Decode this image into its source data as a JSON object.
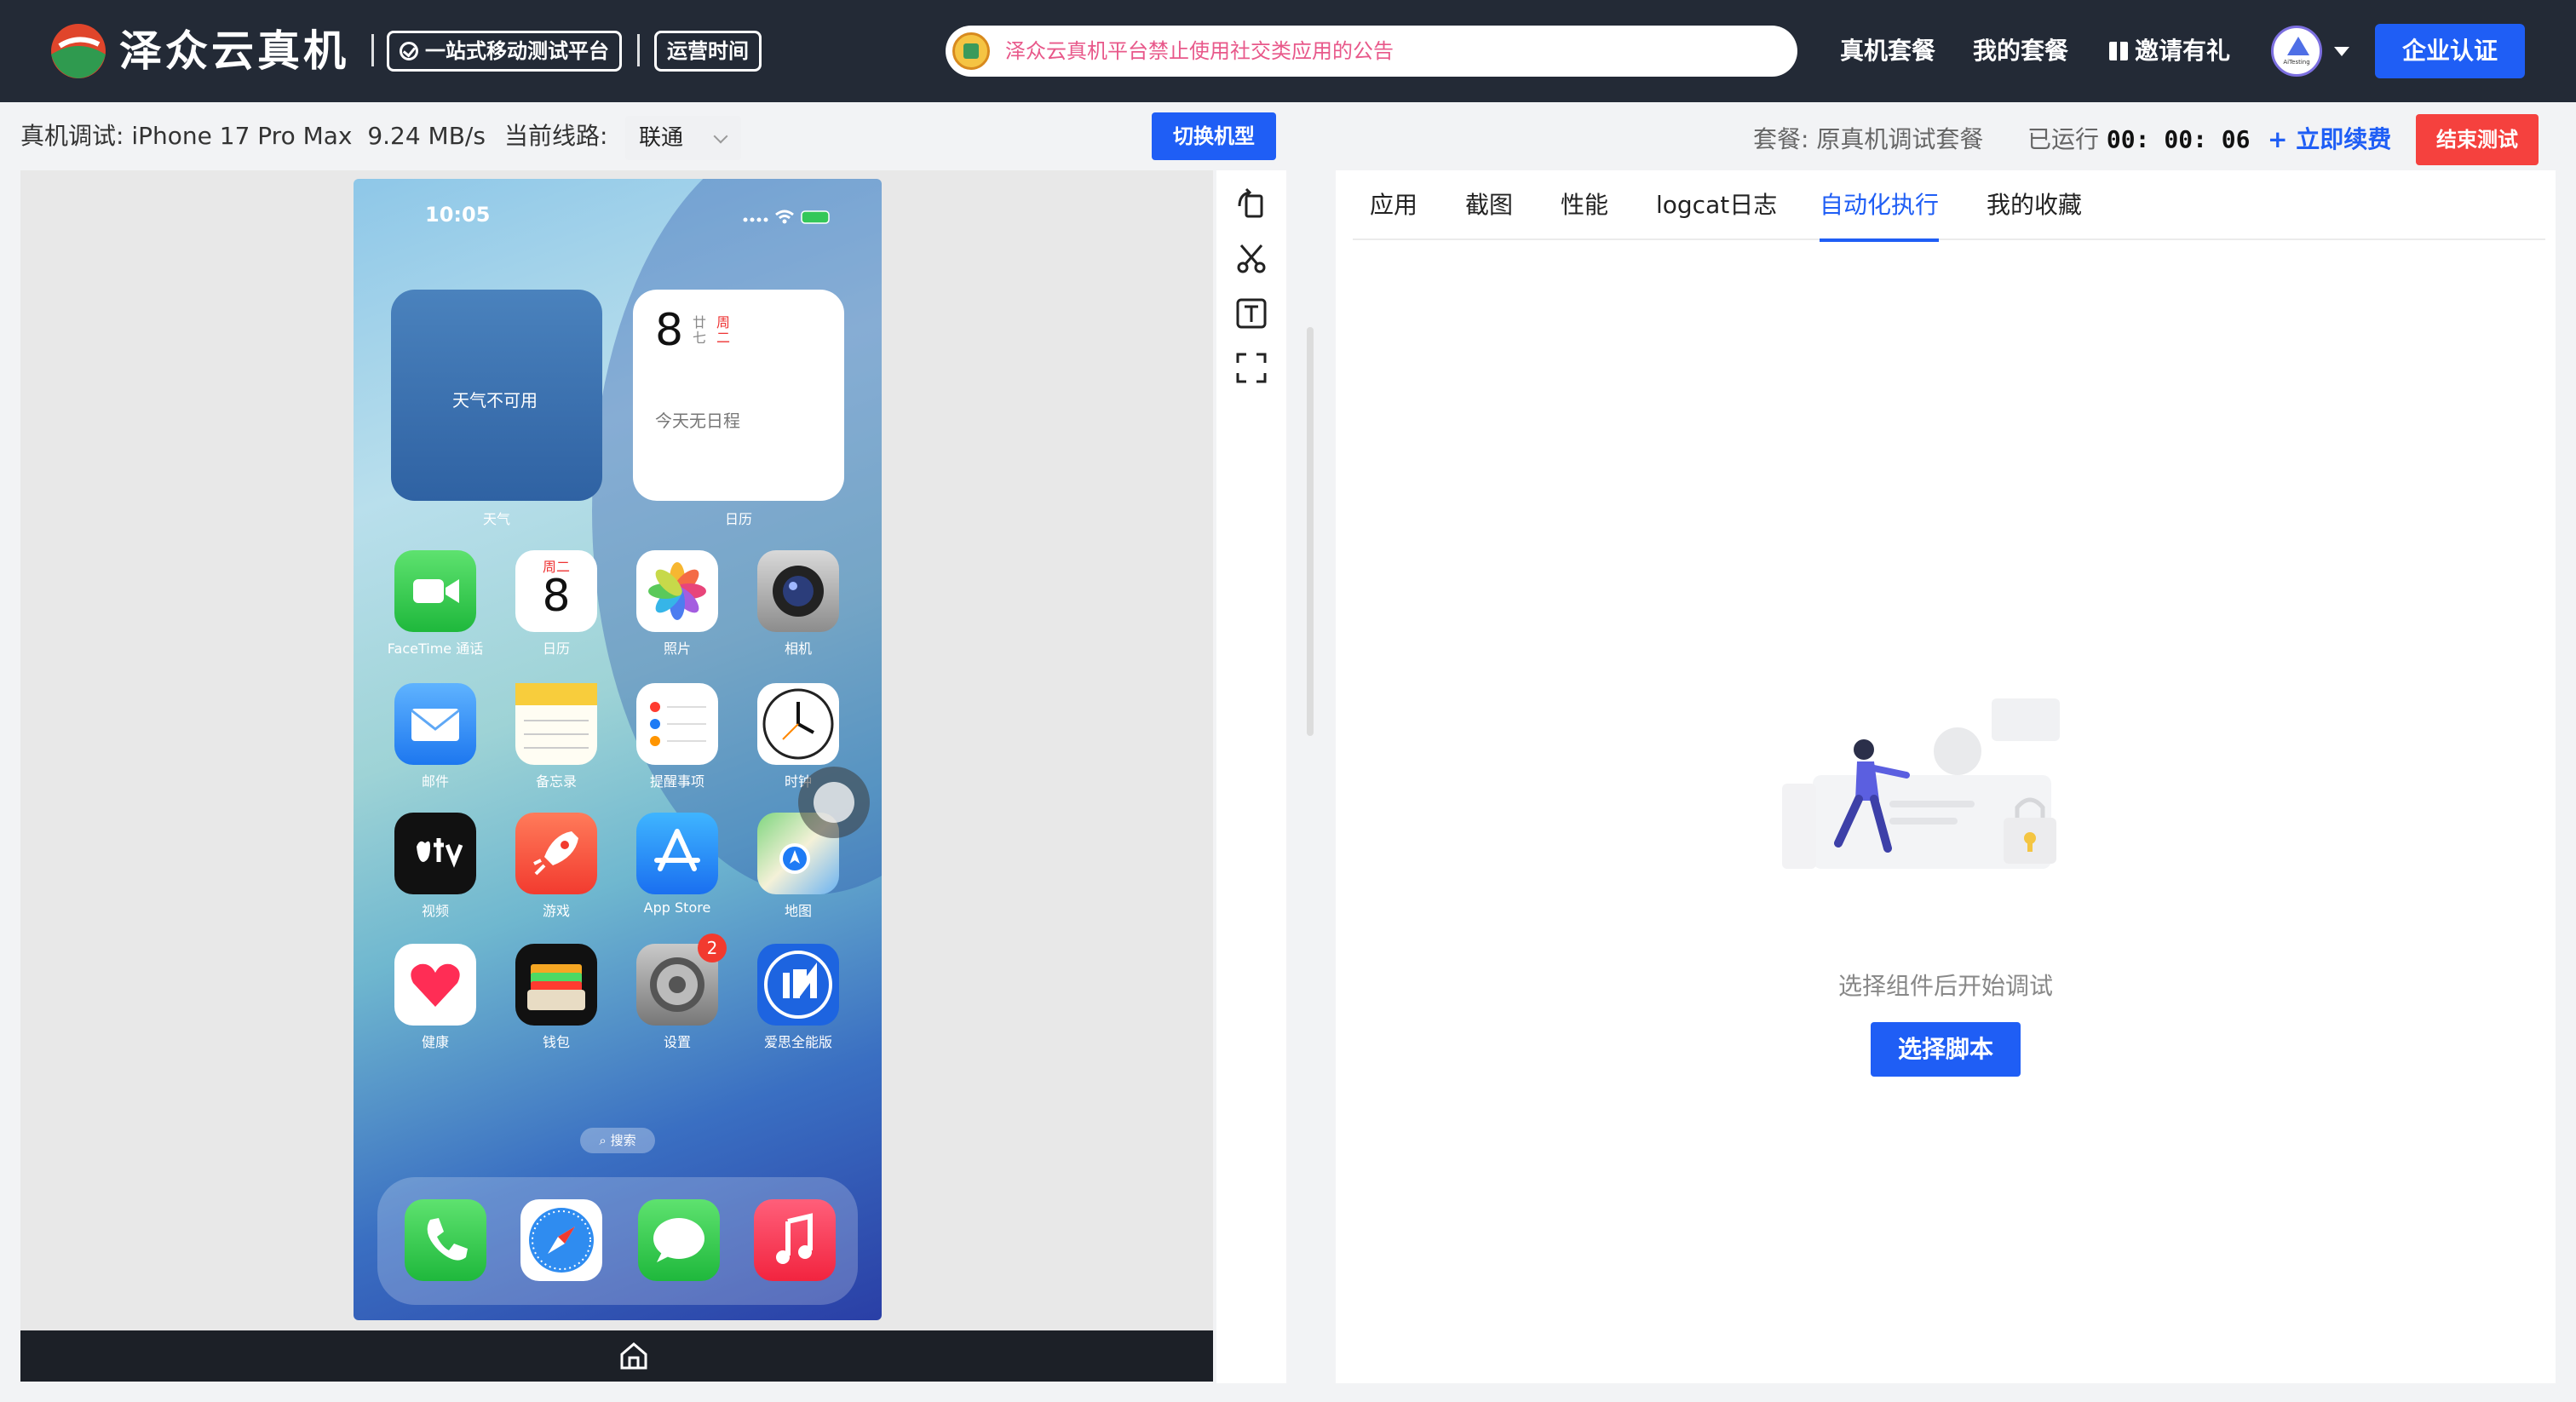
{
  "header": {
    "brand": "泽众云真机",
    "tagline": "一站式移动测试平台",
    "hours_label": "运营时间",
    "notice": "泽众云真机平台禁止使用社交类应用的公告",
    "nav": {
      "real_device_plans": "真机套餐",
      "my_plans": "我的套餐",
      "invite": "邀请有礼"
    },
    "avatar_text": "AiTesting",
    "enterprise_button": "企业认证",
    "colors": {
      "bg": "#232a36",
      "accent": "#1f5ef5"
    }
  },
  "device_bar": {
    "debug_label": "真机调试:",
    "device_name": "iPhone 17 Pro Max",
    "speed": "9.24 MB/s",
    "line_label": "当前线路:",
    "line_value": "联通",
    "switch_button": "切换机型"
  },
  "session": {
    "plan_label": "套餐:",
    "plan_name": "原真机调试套餐",
    "running_label": "已运行",
    "running_time": "00: 00: 06",
    "renew_label": "+ 立即续费",
    "end_button": "结束测试"
  },
  "phone": {
    "time": "10:05",
    "weather_widget": "天气不可用",
    "weather_caption": "天气",
    "calendar_day": "8",
    "calendar_lunar": "廿七",
    "calendar_weekday": "周二",
    "calendar_schedule": "今天无日程",
    "calendar_caption": "日历",
    "apps": [
      {
        "label": "FaceTime 通话",
        "icon": "facetime-icon"
      },
      {
        "label": "日历",
        "icon": "calendar-icon"
      },
      {
        "label": "照片",
        "icon": "photos-icon"
      },
      {
        "label": "相机",
        "icon": "camera-icon"
      },
      {
        "label": "邮件",
        "icon": "mail-icon"
      },
      {
        "label": "备忘录",
        "icon": "notes-icon"
      },
      {
        "label": "提醒事项",
        "icon": "reminders-icon"
      },
      {
        "label": "时钟",
        "icon": "clock-icon"
      },
      {
        "label": "视频",
        "icon": "tv-icon"
      },
      {
        "label": "游戏",
        "icon": "games-icon"
      },
      {
        "label": "App Store",
        "icon": "appstore-icon"
      },
      {
        "label": "地图",
        "icon": "maps-icon"
      },
      {
        "label": "健康",
        "icon": "health-icon"
      },
      {
        "label": "钱包",
        "icon": "wallet-icon"
      },
      {
        "label": "设置",
        "icon": "settings-icon",
        "badge": "2"
      },
      {
        "label": "爱思全能版",
        "icon": "i4-icon"
      }
    ],
    "calendar_icon_weekday": "周二",
    "calendar_icon_day": "8",
    "search_label": "搜索",
    "dock": [
      "phone-icon",
      "safari-icon",
      "messages-icon",
      "music-icon"
    ]
  },
  "tabs": [
    {
      "label": "应用",
      "active": false
    },
    {
      "label": "截图",
      "active": false
    },
    {
      "label": "性能",
      "active": false
    },
    {
      "label": "logcat日志",
      "active": false
    },
    {
      "label": "自动化执行",
      "active": true
    },
    {
      "label": "我的收藏",
      "active": false
    }
  ],
  "empty_state": {
    "message": "选择组件后开始调试",
    "button": "选择脚本"
  }
}
